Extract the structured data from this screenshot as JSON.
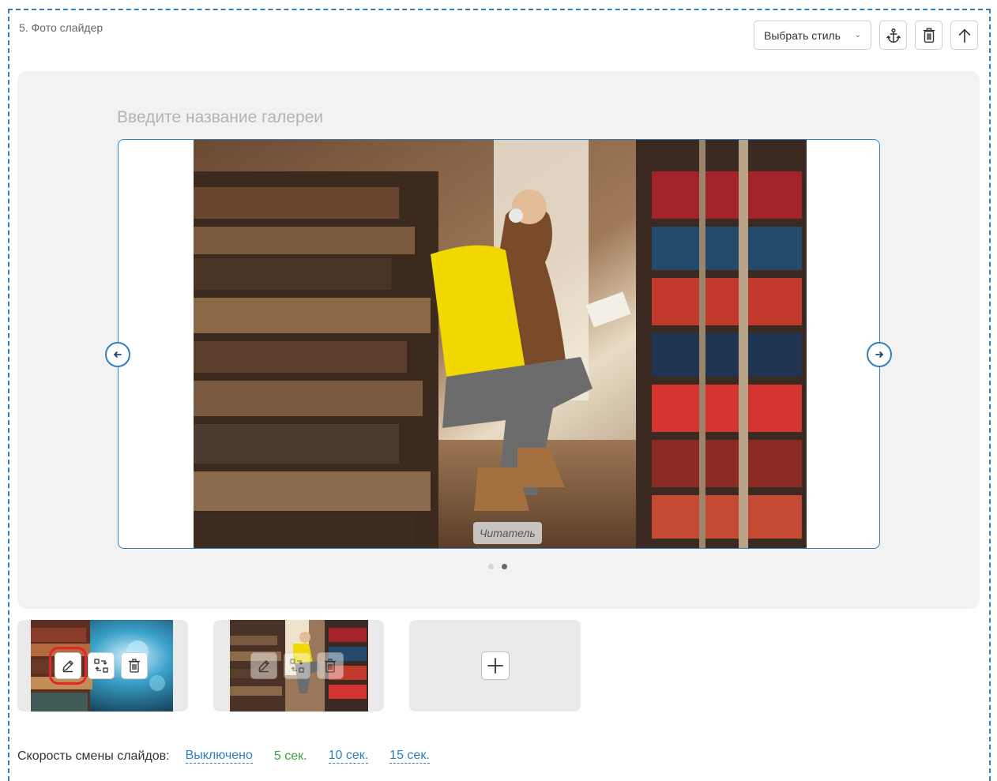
{
  "block": {
    "title": "5. Фото слайдер",
    "style_select": {
      "label": "Выбрать стиль"
    },
    "buttons": {
      "anchor": "anchor-icon",
      "delete": "trash-icon",
      "move_up": "arrow-up-icon"
    }
  },
  "gallery": {
    "title_placeholder": "Введите название галереи",
    "current_slide": {
      "caption": "Читатель"
    },
    "slides_total": 2,
    "active_slide": 2
  },
  "thumbnails": [
    {
      "actions": [
        "edit",
        "replace",
        "delete"
      ],
      "highlighted_action": "edit"
    },
    {
      "actions": [
        "edit",
        "replace",
        "delete"
      ]
    }
  ],
  "speed": {
    "label": "Скорость смены слайдов:",
    "options": [
      "Выключено",
      "5 сек.",
      "10 сек.",
      "15 сек."
    ],
    "active": "5 сек."
  },
  "colors": {
    "accent": "#2f7fc1",
    "active_green": "#3aa33a",
    "highlight_red": "#e0252b"
  }
}
